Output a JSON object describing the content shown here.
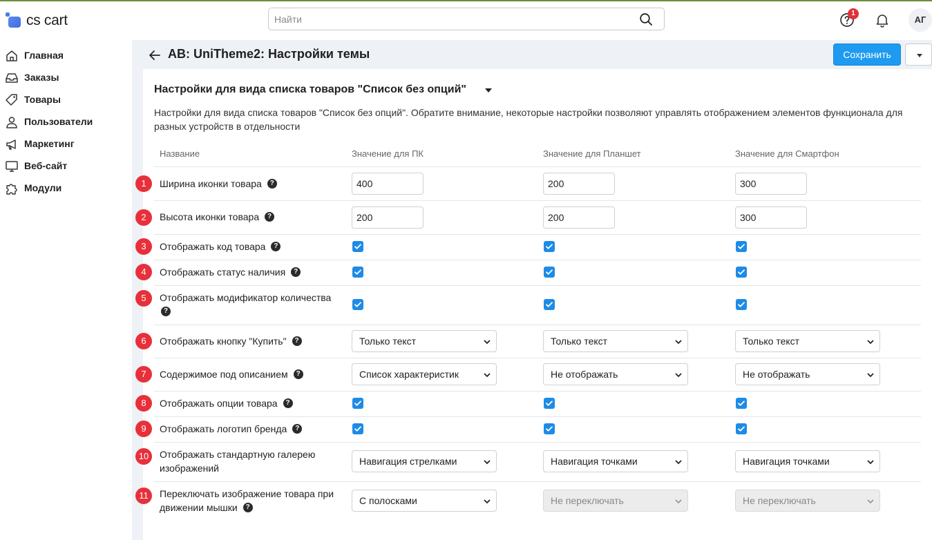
{
  "brand": {
    "name": "cs cart"
  },
  "search": {
    "placeholder": "Найти"
  },
  "header": {
    "help_badge": "1",
    "avatar_initials": "АГ"
  },
  "sidebar": {
    "items": [
      {
        "label": "Главная",
        "icon": "home-icon"
      },
      {
        "label": "Заказы",
        "icon": "inbox-icon"
      },
      {
        "label": "Товары",
        "icon": "tag-icon"
      },
      {
        "label": "Пользователи",
        "icon": "user-icon"
      },
      {
        "label": "Маркетинг",
        "icon": "megaphone-icon"
      },
      {
        "label": "Веб-сайт",
        "icon": "monitor-icon"
      },
      {
        "label": "Модули",
        "icon": "puzzle-icon"
      }
    ]
  },
  "page": {
    "title": "AB: UniTheme2: Настройки темы",
    "save_label": "Сохранить",
    "section_title": "Настройки для вида списка товаров \"Список без опций\"",
    "section_description": "Настройки для вида списка товаров \"Список без опций\". Обратите внимание, некоторые настройки позволяют управлять отображением элементов функционала для разных устройств в отдельности"
  },
  "table": {
    "columns": [
      "Название",
      "Значение для ПК",
      "Значение для Планшет",
      "Значение для Смартфон"
    ],
    "rows": [
      {
        "num": "1",
        "label": "Ширина иконки товара",
        "type": "text",
        "values": [
          "400",
          "200",
          "300"
        ]
      },
      {
        "num": "2",
        "label": "Высота иконки товара",
        "type": "text",
        "values": [
          "200",
          "200",
          "300"
        ]
      },
      {
        "num": "3",
        "label": "Отображать код товара",
        "type": "checkbox",
        "values": [
          true,
          true,
          true
        ]
      },
      {
        "num": "4",
        "label": "Отображать статус наличия",
        "type": "checkbox",
        "values": [
          true,
          true,
          true
        ]
      },
      {
        "num": "5",
        "label": "Отображать модификатор количества",
        "type": "checkbox",
        "values": [
          true,
          true,
          true
        ]
      },
      {
        "num": "6",
        "label": "Отображать кнопку \"Купить\"",
        "type": "select",
        "values": [
          "Только текст",
          "Только текст",
          "Только текст"
        ]
      },
      {
        "num": "7",
        "label": "Содержимое под описанием",
        "type": "select",
        "values": [
          "Список характеристик",
          "Не отображать",
          "Не отображать"
        ]
      },
      {
        "num": "8",
        "label": "Отображать опции товара",
        "type": "checkbox",
        "values": [
          true,
          true,
          true
        ]
      },
      {
        "num": "9",
        "label": "Отображать логотип бренда",
        "type": "checkbox",
        "values": [
          true,
          true,
          true
        ]
      },
      {
        "num": "10",
        "label_lines": [
          "Отображать стандартную галерею",
          "изображений"
        ],
        "type": "select",
        "values": [
          "Навигация стрелками",
          "Навигация точками",
          "Навигация точками"
        ]
      },
      {
        "num": "11",
        "label_lines": [
          "Переключать изображение товара при",
          "движении мышки"
        ],
        "type": "select",
        "values": [
          "С полосками",
          "Не переключать",
          "Не переключать"
        ],
        "disabled": [
          false,
          true,
          true
        ]
      }
    ]
  },
  "colors": {
    "accent": "#1e9bf0",
    "badge": "#e8303a",
    "checkbox": "#1e8be6"
  }
}
